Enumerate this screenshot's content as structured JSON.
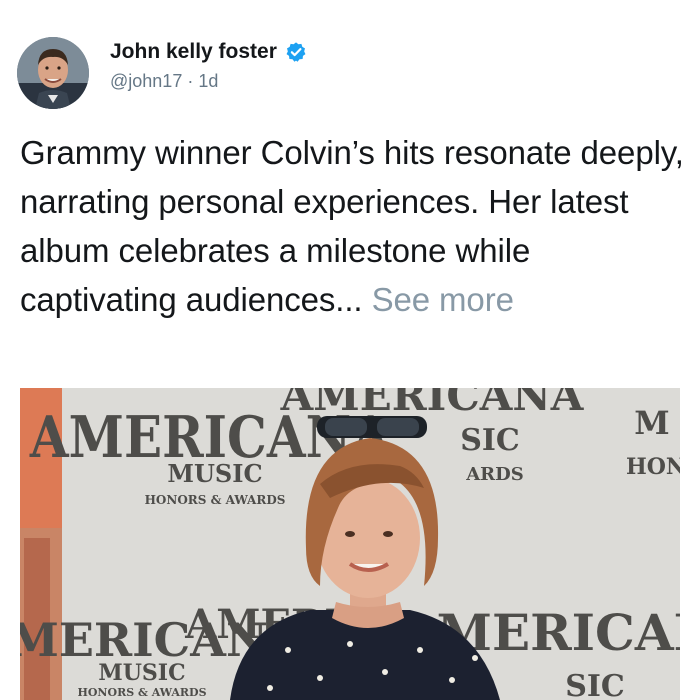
{
  "user": {
    "display_name": "John kelly foster",
    "handle": "@john17",
    "separator": "·",
    "time": "1d",
    "verified_icon": "verified-badge-icon",
    "verified_color": "#1da1f2"
  },
  "tweet": {
    "text": "Grammy winner Colvin’s hits resonate deeply, narrating personal experiences. Her latest album celebrates a milestone while captivating audiences... ",
    "see_more": "See more"
  },
  "media": {
    "backdrop_text": {
      "brand": "AMERICANA",
      "music": "MUSIC",
      "honors": "HONORS & AWARDS",
      "partial_top": "AMERICANA",
      "partial_sic": "SIC",
      "partial_ards": "ARDS",
      "partial_right_m": "M",
      "partial_right_hon": "HON",
      "partial_mid": "AMERIC",
      "partial_sic_bottom": "SIC"
    }
  },
  "colors": {
    "text": "#14171a",
    "secondary": "#657786",
    "see_more": "#8899a6"
  }
}
